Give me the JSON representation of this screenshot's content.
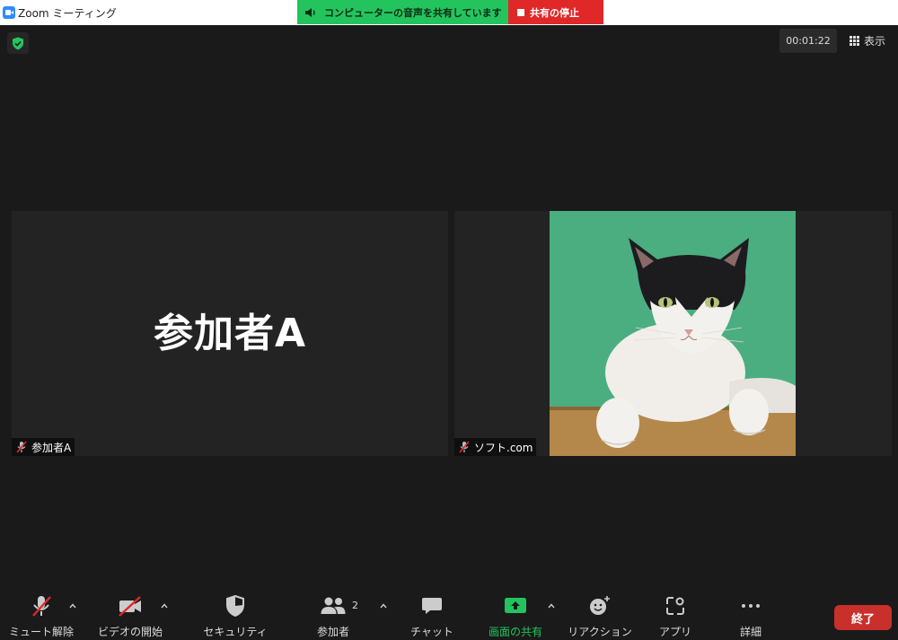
{
  "window": {
    "title": "Zoom ミーティング"
  },
  "share_banner": {
    "status_text": "コンピューターの音声を共有しています",
    "stop_label": "共有の停止"
  },
  "top_right": {
    "timer": "00:01:22",
    "view_label": "表示"
  },
  "tiles": [
    {
      "display_name": "参加者A",
      "name_tag": "参加者A",
      "muted": true
    },
    {
      "name_tag": "ソフト.com",
      "muted": true
    }
  ],
  "toolbar": {
    "mute": "ミュート解除",
    "video": "ビデオの開始",
    "security": "セキュリティ",
    "participants": "参加者",
    "participants_count": "2",
    "chat": "チャット",
    "share": "画面の共有",
    "reactions": "リアクション",
    "apps": "アプリ",
    "more": "詳細",
    "end": "終了"
  },
  "colors": {
    "accent_green": "#23c45e",
    "stop_red": "#e02828",
    "end_red": "#c9302c"
  }
}
